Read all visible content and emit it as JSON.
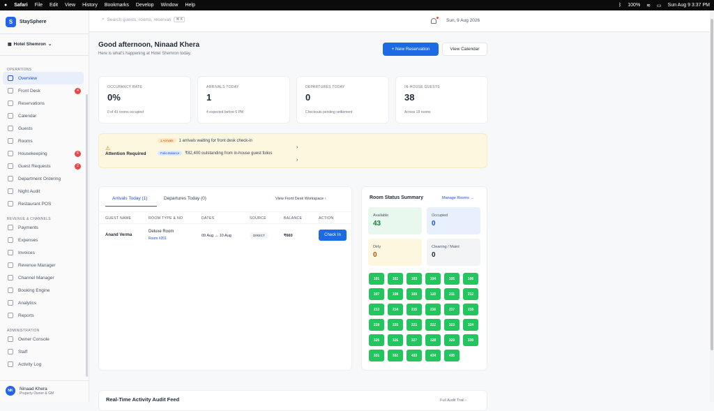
{
  "menubar": {
    "apple": "",
    "app": "Safari",
    "items": [
      "File",
      "Edit",
      "View",
      "History",
      "Bookmarks",
      "Develop",
      "Window",
      "Help"
    ],
    "battery": "100%",
    "clock": "Sun Aug 9  3:37 PM"
  },
  "brand": {
    "logo": "S",
    "name": "StaySphere"
  },
  "hotel": {
    "name": "Hotel Shemron",
    "chev": "⌄"
  },
  "nav": {
    "ops": "OPERATIONS",
    "ops_items": [
      {
        "label": "Overview",
        "active": true
      },
      {
        "label": "Front Desk",
        "badge": "4"
      },
      {
        "label": "Reservations"
      },
      {
        "label": "Calendar"
      },
      {
        "label": "Guests"
      },
      {
        "label": "Rooms"
      },
      {
        "label": "Housekeeping",
        "badge": "6"
      },
      {
        "label": "Guest Requests",
        "badge": "2"
      },
      {
        "label": "Department Ordering"
      },
      {
        "label": "Night Audit"
      },
      {
        "label": "Restaurant POS"
      }
    ],
    "rev": "REVENUE & CHANNELS",
    "rev_items": [
      {
        "label": "Payments"
      },
      {
        "label": "Expenses"
      },
      {
        "label": "Invoices"
      },
      {
        "label": "Revenue Manager"
      },
      {
        "label": "Channel Manager"
      },
      {
        "label": "Booking Engine"
      },
      {
        "label": "Analytics"
      },
      {
        "label": "Reports"
      }
    ],
    "adm": "ADMINISTRATION",
    "adm_items": [
      {
        "label": "Owner Console"
      },
      {
        "label": "Staff"
      },
      {
        "label": "Activity Log"
      }
    ]
  },
  "user": {
    "initials": "NK",
    "name": "Ninaad Khera",
    "role": "Property Owner & GM"
  },
  "topbar": {
    "search_placeholder": "Search guests, rooms, reservati",
    "kbd": "⌘ K",
    "date": "Sun, 9 Aug 2026"
  },
  "header": {
    "greeting": "Good afternoon, Ninaad Khera",
    "subtitle": "Here is what's happening at Hotel Shemron today.",
    "new_res": "+ New Reservation",
    "view_cal": "View Calendar"
  },
  "stats": [
    {
      "label": "OCCUPANCY RATE",
      "value": "0%",
      "desc": "0 of 43 rooms occupied"
    },
    {
      "label": "ARRIVALS TODAY",
      "value": "1",
      "desc": "4 expected before 6 PM"
    },
    {
      "label": "DEPARTURES TODAY",
      "value": "0",
      "desc": "Checkouts pending settlement"
    },
    {
      "label": "IN-HOUSE GUESTS",
      "value": "38",
      "desc": "Across 18 rooms"
    }
  ],
  "alert": {
    "title": "Attention Required",
    "warn": "⚠",
    "p1": "1 Arrivals",
    "t1": "1 arrivals waiting for front desk check-in",
    "p2": "Folio Balance",
    "t2": "₹82,400 outstanding from in-house guest folios",
    "chev": "›"
  },
  "arrivals": {
    "tab1": "Arrivals Today (1)",
    "tab2": "Departures Today (0)",
    "link": "View Front Desk Workspace  ›",
    "cols": [
      "GUEST NAME",
      "ROOM TYPE & NO",
      "DATES",
      "SOURCE",
      "BALANCE",
      "ACTION"
    ],
    "row": {
      "guest": "Anand Verma",
      "room_type": "Deluxe Room",
      "room_no": "Room #201",
      "dates": "09 Aug → 10 Aug",
      "source": "DIRECT",
      "balance": "₹660",
      "action": "Check In"
    }
  },
  "rooms": {
    "title": "Room Status Summary",
    "manage": "Manage Rooms →",
    "available_l": "Available",
    "available_v": "43",
    "occupied_l": "Occupied",
    "occupied_v": "0",
    "dirty_l": "Dirty",
    "dirty_v": "0",
    "clean_l": "Cleaning / Maint",
    "clean_v": "0",
    "colors": {
      "available": "#e9f8ee",
      "occupied": "#e8f0fe",
      "dirty": "#fdf7e0",
      "clean": "#f3f4f6",
      "room": "#22c55e"
    },
    "list": [
      "101",
      "102",
      "103",
      "104",
      "105",
      "106",
      "107",
      "108",
      "109",
      "110",
      "211",
      "212",
      "213",
      "214",
      "215",
      "216",
      "217",
      "218",
      "219",
      "220",
      "221",
      "222",
      "323",
      "324",
      "325",
      "326",
      "327",
      "328",
      "329",
      "330",
      "331",
      "332",
      "433",
      "434",
      "435"
    ]
  },
  "audit": {
    "title": "Real-Time Activity Audit Feed",
    "link": "Full Audit Trail  ›"
  }
}
